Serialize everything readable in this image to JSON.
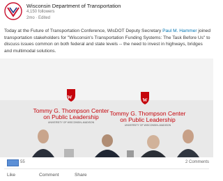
{
  "post": {
    "org_name": "Wisconsin Department of Transportation",
    "followers": "4,150 followers",
    "age": "2mo · Edited",
    "text_before_link": "Today at the Future of Transportation Conference, WisDOT Deputy Secretary ",
    "link_text": "Paul M. Hammer",
    "text_after_link": " joined transportation stakeholders for \"Wisconsin's Transportation Funding Systems: The Task Before Us\" to discuss issues common on both federal and state levels -- the need to invest in highways, bridges and multimodal solutions."
  },
  "photo": {
    "banner_left": {
      "line1": "Tommy G. Thompson Center",
      "line2": "on Public Leadership",
      "line3": "UNIVERSITY OF WISCONSIN–MADISON"
    },
    "banner_right": {
      "line1": "Tommy G. Thompson Center",
      "line2": "on Public Leadership",
      "line3": "UNIVERSITY OF WISCONSIN–MADISON"
    }
  },
  "stats": {
    "likes": "55",
    "comments": "2 Comments"
  },
  "actions": {
    "like": "Like",
    "comment": "Comment",
    "share": "Share"
  },
  "colors": {
    "link": "#0073b1",
    "banner_red": "#c5050c",
    "reaction_badge": "#5b8fd6"
  }
}
